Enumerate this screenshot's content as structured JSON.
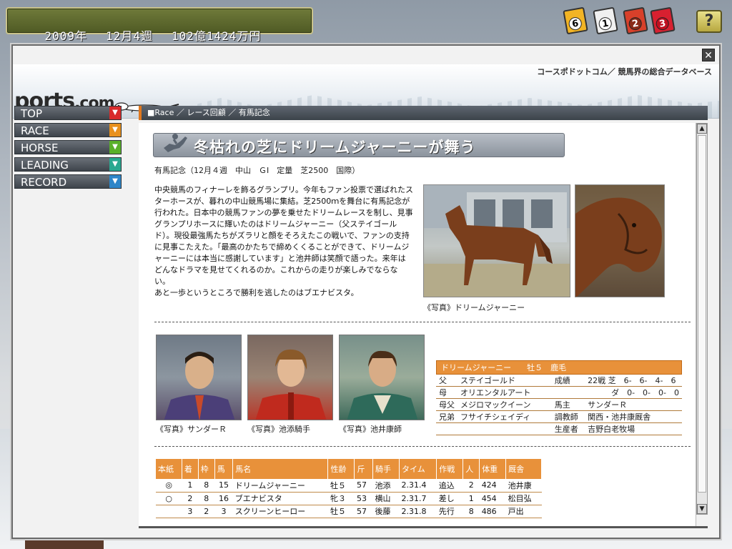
{
  "status": {
    "year": "2009年",
    "week": "12月4週",
    "money": "102億1424万円"
  },
  "cards": [
    {
      "icon": "ticket-card-icon",
      "number": "6",
      "color": "#f2b424"
    },
    {
      "icon": "ticket-card-icon",
      "number": "1",
      "color": "#f0f0f0"
    },
    {
      "icon": "ticket-card-icon",
      "number": "2",
      "color": "#d8402a"
    },
    {
      "icon": "ticket-card-icon",
      "number": "3",
      "color": "#d82030"
    }
  ],
  "help_label": "?",
  "window": {
    "close_label": "✕",
    "tagline": "コースポドットコム／ 競馬界の総合データベース",
    "logo": {
      "main": "ports",
      "suffix": ".com"
    }
  },
  "nav": [
    {
      "label": "TOP",
      "arrow_color": "#d82b2b"
    },
    {
      "label": "RACE",
      "arrow_color": "#e8901c"
    },
    {
      "label": "HORSE",
      "arrow_color": "#5ab02a"
    },
    {
      "label": "LEADING",
      "arrow_color": "#2aa890"
    },
    {
      "label": "RECORD",
      "arrow_color": "#2e86c8"
    }
  ],
  "breadcrumb": "■Race ／ レース回顧 ／ 有馬記念",
  "article": {
    "headline": "冬枯れの芝にドリームジャーニーが舞う",
    "race_info": "有馬記念（12月４週　中山　ＧⅠ　定量　芝2500　国際）",
    "body": "中央競馬のフィナーレを飾るグランプリ。今年もファン投票で選ばれたスターホースが、暮れの中山競馬場に集結。芝2500ｍを舞台に有馬記念が行われた。日本中の競馬ファンの夢を乗せたドリームレースを制し、見事グランプリホースに輝いたのはドリームジャーニー（父ステイゴールド）。現役最強馬たちがズラリと顔をそろえたこの戦いで、ファンの支持に見事こたえた。「最高のかたちで締めくくることができて、ドリームジャーニーには本当に感謝しています」と池井師は笑顔で語った。来年はどんなドラマを見せてくれるのか。これからの走りが楽しみでならない。",
    "body2": "あと一歩というところで勝利を逃したのはブエナビスタ。",
    "photo_caption": "《写真》ドリームジャーニー"
  },
  "portraits": [
    {
      "caption": "《写真》サンダーＲ"
    },
    {
      "caption": "《写真》池添騎手"
    },
    {
      "caption": "《写真》池井康師"
    }
  ],
  "horse_info": {
    "header": "ドリームジャーニー　　牡５　鹿毛",
    "rows": [
      {
        "k": "父",
        "v": "ステイゴールド",
        "k2": "成績",
        "v2": "22戦 芝　6-　6-　4-　6"
      },
      {
        "k": "母",
        "v": "オリエンタルアート",
        "k2": "",
        "v2": "　　　ダ　0-　0-　0-　0"
      },
      {
        "k": "母父",
        "v": "メジロマックイーン",
        "k2": "馬主",
        "v2": "サンダーＲ"
      },
      {
        "k": "兄弟",
        "v": "フサイチシェイディ",
        "k2": "調教師",
        "v2": "関西・池井康厩舎"
      },
      {
        "k": "",
        "v": "",
        "k2": "生産者",
        "v2": "吉野白老牧場"
      }
    ]
  },
  "results": {
    "headers": [
      "本紙",
      "着",
      "枠",
      "馬",
      "馬名",
      "性齢",
      "斤",
      "騎手",
      "タイム",
      "作戦",
      "人",
      "体重",
      "厩舎"
    ],
    "rows": [
      [
        "◎",
        "1",
        "8",
        "15",
        "ドリームジャーニー",
        "牡５",
        "57",
        "池添",
        "2.31.4",
        "追込",
        "2",
        "424",
        "池井康"
      ],
      [
        "○",
        "2",
        "8",
        "16",
        "ブエナビスタ",
        "牝３",
        "53",
        "横山",
        "2.31.7",
        "差し",
        "1",
        "454",
        "松目弘"
      ],
      [
        "",
        "3",
        "2",
        "3",
        "スクリーンヒーロー",
        "牡５",
        "57",
        "後藤",
        "2.31.8",
        "先行",
        "8",
        "486",
        "戸出"
      ]
    ]
  }
}
